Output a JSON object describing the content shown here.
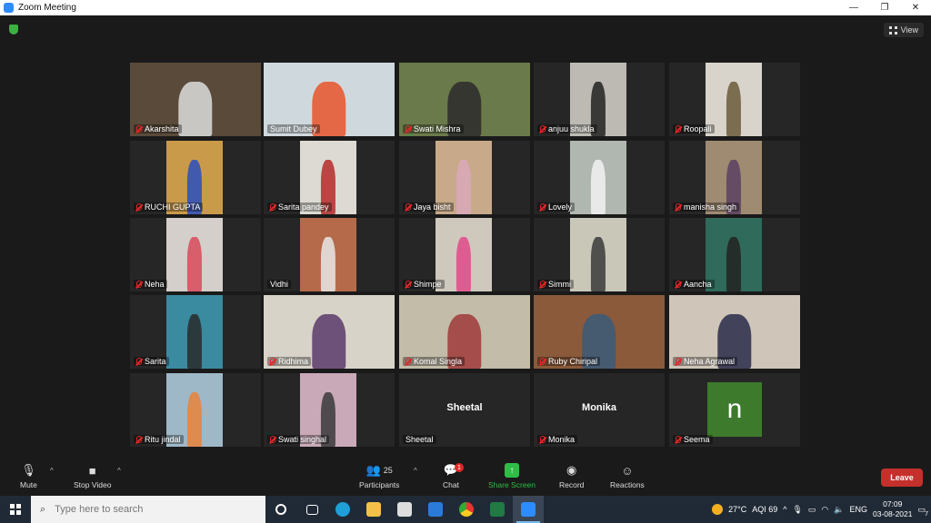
{
  "window": {
    "title": "Zoom Meeting",
    "minimize": "—",
    "restore": "❐",
    "close": "✕"
  },
  "view_button": {
    "label": "View",
    "icon": "grid-icon"
  },
  "tiles": [
    {
      "name": "Akarshita",
      "muted": true,
      "bg": "#5a4a3a",
      "shirt": "#ddd"
    },
    {
      "name": "Sumit Dubey",
      "muted": false,
      "active": true,
      "bg": "#cfd9dd",
      "shirt": "#e8542a"
    },
    {
      "name": "Swati Mishra",
      "muted": true,
      "bg": "#6b7a4a",
      "shirt": "#2a2a2a"
    },
    {
      "name": "anjuu shukla",
      "muted": true,
      "bg": "#bcbab3",
      "shirt": "#222"
    },
    {
      "name": "Roopali",
      "muted": true,
      "bg": "#d8d4cc",
      "shirt": "#6b5a3a"
    },
    {
      "name": "RUCHI GUPTA",
      "muted": true,
      "bg": "#c99a4a",
      "shirt": "#2a4fbf"
    },
    {
      "name": "Sarita pandey",
      "muted": true,
      "bg": "#dcdad2",
      "shirt": "#b52a2a"
    },
    {
      "name": "Jaya bisht",
      "muted": true,
      "bg": "#c8a98a",
      "shirt": "#d9a9b8"
    },
    {
      "name": "Lovely",
      "muted": true,
      "bg": "#b0b7b0",
      "shirt": "#f2f2f2"
    },
    {
      "name": "manisha singh",
      "muted": true,
      "bg": "#9f8a72",
      "shirt": "#5a4060"
    },
    {
      "name": "Neha",
      "muted": true,
      "bg": "#d4cfca",
      "shirt": "#d84a5a"
    },
    {
      "name": "Vidhi",
      "muted": false,
      "bg": "#b56a4a",
      "shirt": "#e8e8e8"
    },
    {
      "name": "Shimpe",
      "muted": true,
      "bg": "#cfc8bd",
      "shirt": "#e04a8a"
    },
    {
      "name": "Simmi",
      "muted": true,
      "bg": "#c9c7b8",
      "shirt": "#3a3a3a"
    },
    {
      "name": "Aancha",
      "muted": true,
      "bg": "#2f6a5a",
      "shirt": "#222"
    },
    {
      "name": "Sarita",
      "muted": true,
      "bg": "#3a8aa0",
      "shirt": "#2a2a2a"
    },
    {
      "name": "Ridhima",
      "muted": true,
      "bg": "#d8d3c8",
      "shirt": "#5a3a6a"
    },
    {
      "name": "Komal Singla",
      "muted": true,
      "bg": "#c2bca8",
      "shirt": "#a03a3a"
    },
    {
      "name": "Ruby Chiripal",
      "muted": true,
      "bg": "#8a5a3a",
      "shirt": "#3a5a7a"
    },
    {
      "name": "Neha Agrawal",
      "muted": true,
      "bg": "#cfc5b8",
      "shirt": "#2a2a4a"
    },
    {
      "name": "Ritu jindal",
      "muted": true,
      "bg": "#9fb8c8",
      "shirt": "#e8823a"
    },
    {
      "name": "Swati singhal",
      "muted": true,
      "bg": "#c9a9b8",
      "shirt": "#3a3a3a"
    },
    {
      "name": "Sheetal",
      "muted": false,
      "bigname": "Sheetal"
    },
    {
      "name": "Monika",
      "muted": true,
      "bigname": "Monika"
    },
    {
      "name": "Seema",
      "muted": true,
      "avatar": "n"
    }
  ],
  "toolbar": {
    "mute_label": "Mute",
    "stop_video_label": "Stop Video",
    "participants_label": "Participants",
    "participants_count": "25",
    "chat_label": "Chat",
    "chat_badge": "1",
    "share_screen_label": "Share Screen",
    "record_label": "Record",
    "reactions_label": "Reactions",
    "leave_label": "Leave"
  },
  "taskbar": {
    "search_placeholder": "Type here to search",
    "weather_temp": "27°C",
    "aqi": "AQI 69",
    "language": "ENG",
    "time": "07:09",
    "date": "03-08-2021",
    "notification_count": "7"
  }
}
